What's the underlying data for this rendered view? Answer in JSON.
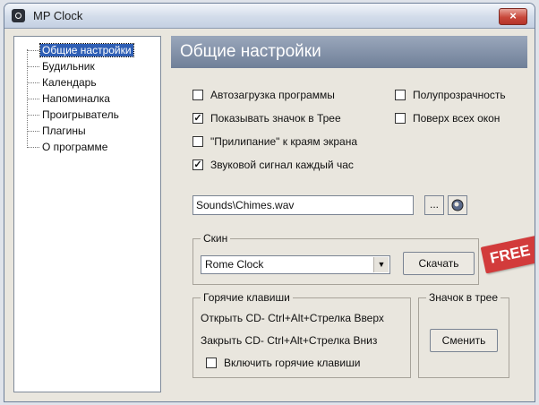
{
  "window": {
    "title": "MP Clock",
    "close_label": "×"
  },
  "tree": {
    "items": [
      {
        "label": "Общие настройки"
      },
      {
        "label": "Будильник"
      },
      {
        "label": "Календарь"
      },
      {
        "label": "Напоминалка"
      },
      {
        "label": "Проигрыватель"
      },
      {
        "label": "Плагины"
      },
      {
        "label": "О программе"
      }
    ],
    "selected": "Общие настройки"
  },
  "panel": {
    "header": "Общие настройки",
    "checkboxes": [
      {
        "label": "Автозагрузка программы",
        "checked": false
      },
      {
        "label": "Показывать значок в Трее",
        "checked": true
      },
      {
        "label": "\"Прилипание\" к краям экрана",
        "checked": false
      },
      {
        "label": "Звуковой сигнал каждый час",
        "checked": true
      },
      {
        "label": "Полупрозрачность",
        "checked": false
      },
      {
        "label": "Поверх всех окон",
        "checked": false
      }
    ],
    "sound_file": {
      "value": "Sounds\\Chimes.wav",
      "browse_label": "..."
    },
    "skin": {
      "title": "Скин",
      "selected": "Rome Clock",
      "download_label": "Скачать"
    },
    "hotkeys": {
      "title": "Горячие клавиши",
      "line1": "Открыть CD- Ctrl+Alt+Стрелка Вверх",
      "line2": "Закрыть CD- Ctrl+Alt+Стрелка Вниз",
      "enable_label": "Включить горячие клавиши",
      "enable_checked": false
    },
    "tray": {
      "title": "Значок в трее",
      "change_label": "Сменить"
    }
  },
  "overlay": {
    "badge": "FREE"
  },
  "colors": {
    "header_bg": "#7f8da5",
    "selection": "#2f5fb5",
    "badge": "#d23b3b"
  }
}
